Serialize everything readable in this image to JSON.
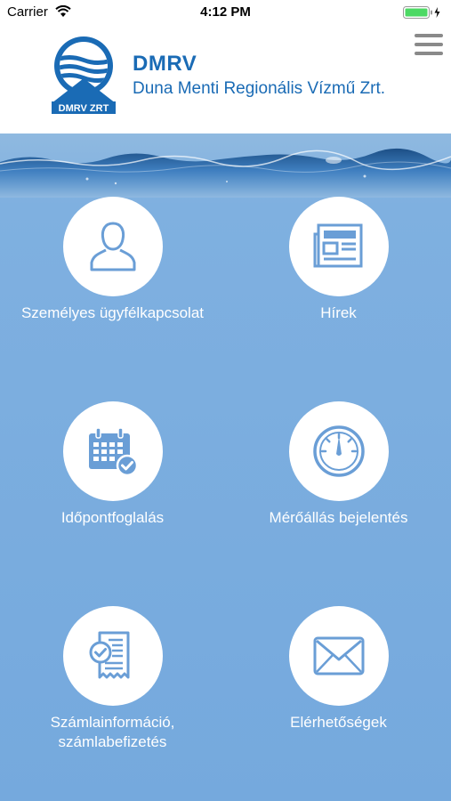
{
  "status_bar": {
    "carrier": "Carrier",
    "time": "4:12 PM"
  },
  "header": {
    "logo_text": "DMRV ZRT",
    "title": "DMRV",
    "subtitle": "Duna Menti Regionális Vízmű Zrt."
  },
  "tiles": [
    {
      "label": "Személyes ügyfélkapcsolat",
      "icon": "person-icon"
    },
    {
      "label": "Hírek",
      "icon": "newspaper-icon"
    },
    {
      "label": "Időpontfoglalás",
      "icon": "calendar-check-icon"
    },
    {
      "label": "Mérőállás bejelentés",
      "icon": "gauge-icon"
    },
    {
      "label_line1": "Számlainformáció,",
      "label_line2": "számlabefizetés",
      "icon": "invoice-check-icon"
    },
    {
      "label": "Elérhetőségek",
      "icon": "envelope-icon"
    }
  ],
  "colors": {
    "brand": "#1a6bb5",
    "icon": "#6a9ed6",
    "water": "#7fb0e0"
  }
}
